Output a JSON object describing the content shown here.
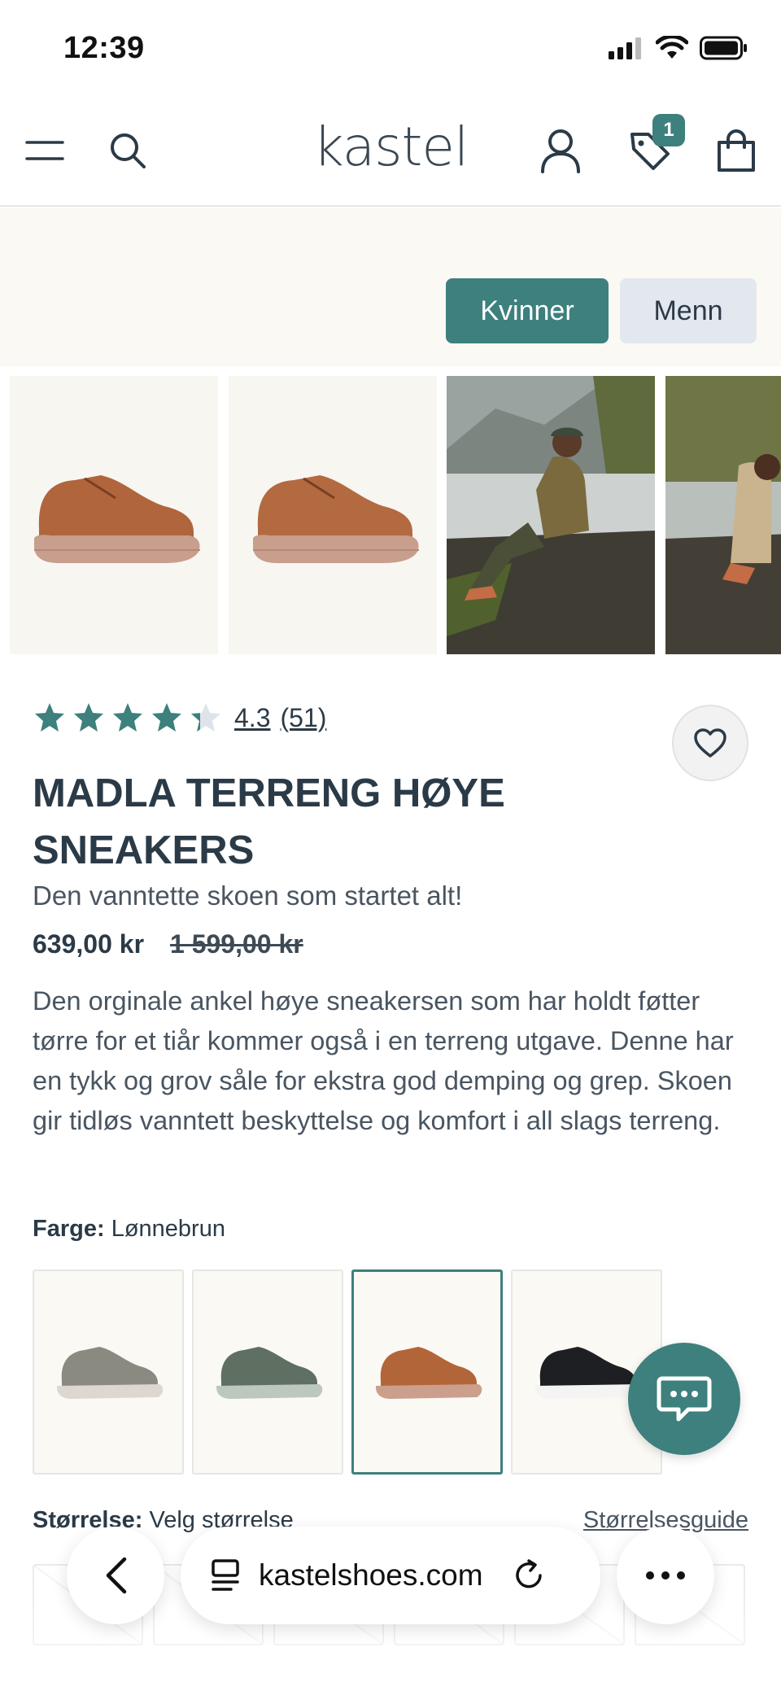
{
  "status_bar": {
    "time": "12:39"
  },
  "header": {
    "logo": "kastel",
    "wishlist_count": "1"
  },
  "gender_toggle": {
    "women": "Kvinner",
    "men": "Menn"
  },
  "product": {
    "rating": "4.3",
    "rating_value": 4.3,
    "review_count": "(51)",
    "title": "MADLA TERRENG HØYE SNEAKERS",
    "subtitle": "Den vanntette skoen som startet alt!",
    "price": "639,00 kr",
    "original_price": "1 599,00 kr",
    "description": "Den orginale ankel høye sneakersen som har holdt føtter tørre for et tiår kommer også i en terreng utgave. Denne har en tykk og grov såle for ekstra god demping og grep. Skoen gir tidløs vanntett beskyttelse og komfort i all slags terreng.",
    "color_label": "Farge:",
    "color_value": "Lønnebrun",
    "size_label": "Størrelse:",
    "size_value": "Velg størrelse",
    "size_guide": "Størrelsesguide"
  },
  "colors": {
    "accent": "#3d807d",
    "text": "#2b3a47",
    "swatches": [
      "#8a8a80",
      "#5f6f62",
      "#b3653a",
      "#1e1f22"
    ]
  },
  "browser": {
    "url": "kastelshoes.com"
  }
}
